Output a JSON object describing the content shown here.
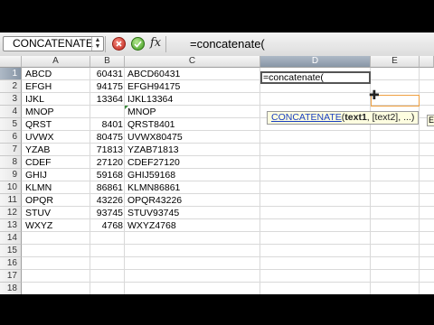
{
  "namebox": {
    "value": "CONCATENATE"
  },
  "formula_bar": {
    "fx_label": "fx",
    "formula": "=concatenate("
  },
  "columns": [
    "A",
    "B",
    "C",
    "D",
    "E"
  ],
  "active_column": "D",
  "rows": [
    {
      "n": "1",
      "a": "ABCD",
      "b": "60431",
      "c": "ABCD60431"
    },
    {
      "n": "2",
      "a": "EFGH",
      "b": "94175",
      "c": "EFGH94175"
    },
    {
      "n": "3",
      "a": "IJKL",
      "b": "13364",
      "c": "IJKL13364"
    },
    {
      "n": "4",
      "a": "MNOP",
      "b": "",
      "c": "MNOP"
    },
    {
      "n": "5",
      "a": "QRST",
      "b": "8401",
      "c": "QRST8401"
    },
    {
      "n": "6",
      "a": "UVWX",
      "b": "80475",
      "c": "UVWX80475"
    },
    {
      "n": "7",
      "a": "YZAB",
      "b": "71813",
      "c": "YZAB71813"
    },
    {
      "n": "8",
      "a": "CDEF",
      "b": "27120",
      "c": "CDEF27120"
    },
    {
      "n": "9",
      "a": "GHIJ",
      "b": "59168",
      "c": "GHIJ59168"
    },
    {
      "n": "10",
      "a": "KLMN",
      "b": "86861",
      "c": "KLMN86861"
    },
    {
      "n": "11",
      "a": "OPQR",
      "b": "43226",
      "c": "OPQR43226"
    },
    {
      "n": "12",
      "a": "STUV",
      "b": "93745",
      "c": "STUV93745"
    },
    {
      "n": "13",
      "a": "WXYZ",
      "b": "4768",
      "c": "WXYZ4768"
    },
    {
      "n": "14",
      "a": "",
      "b": "",
      "c": ""
    },
    {
      "n": "15",
      "a": "",
      "b": "",
      "c": ""
    },
    {
      "n": "16",
      "a": "",
      "b": "",
      "c": ""
    },
    {
      "n": "17",
      "a": "",
      "b": "",
      "c": ""
    },
    {
      "n": "18",
      "a": "",
      "b": "",
      "c": ""
    }
  ],
  "active_cell": {
    "ref": "D1",
    "edit_text": "=concatenate("
  },
  "tooltip": {
    "function": "CONCATENATE",
    "open": "(",
    "arg1": "text1",
    "rest": ", [text2], ...)"
  },
  "tooltip2": {
    "text": "E"
  },
  "colors": {
    "accent_header": "#8896a6",
    "tooltip_bg": "#fdfde0",
    "link": "#1a3fbf"
  }
}
